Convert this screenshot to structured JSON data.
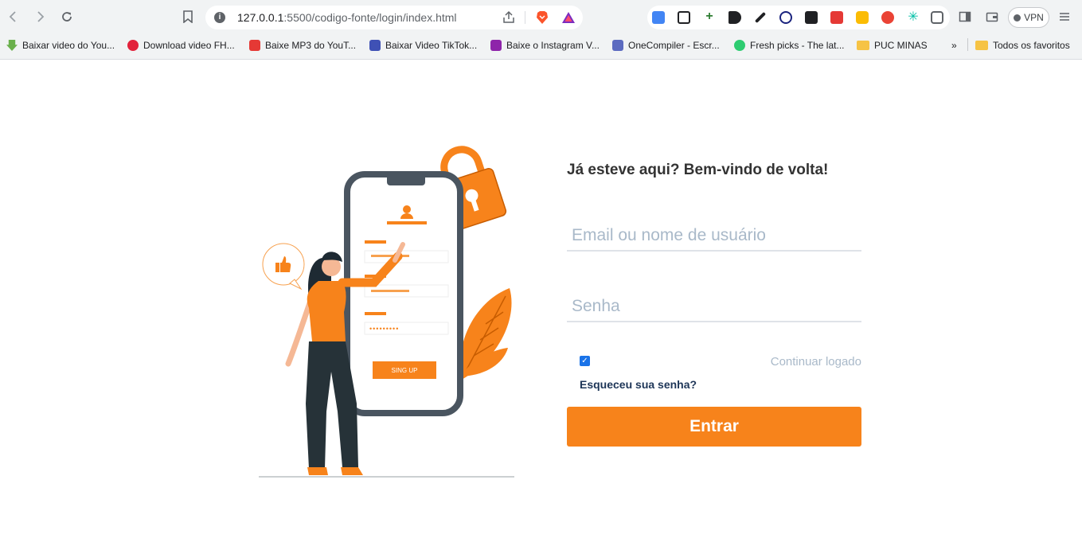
{
  "browser": {
    "url_host": "127.0.0.1",
    "url_path": ":5500/codigo-fonte/login/index.html",
    "vpn_label": "VPN",
    "bookmarks": [
      {
        "label": "Baixar video do You...",
        "color": "#6ab04c"
      },
      {
        "label": "Download video FH...",
        "color": "#e2223b"
      },
      {
        "label": "Baixe MP3 do YouT...",
        "color": "#e53935"
      },
      {
        "label": "Baixar Video TikTok...",
        "color": "#3f51b5"
      },
      {
        "label": "Baixe o Instagram V...",
        "color": "#8e24aa"
      },
      {
        "label": "OneCompiler - Escr...",
        "color": "#5c6bc0"
      },
      {
        "label": "Fresh picks - The lat...",
        "color": "#2ecc71"
      },
      {
        "label": "PUC MINAS",
        "color": "#f6c344"
      }
    ],
    "more_label": "»",
    "all_favorites_label": "Todos os favoritos"
  },
  "illustration": {
    "button_text": "SING UP",
    "password_mask": "•••••••••",
    "accent_color": "#f7831b",
    "dark_color": "#4a5560"
  },
  "login": {
    "heading": "Já esteve aqui? Bem-vindo de volta!",
    "email_placeholder": "Email ou nome de usuário",
    "email_value": "",
    "password_placeholder": "Senha",
    "password_value": "",
    "keep_logged_checked": true,
    "keep_logged_label": "Continuar logado",
    "forgot_label": "Esqueceu sua senha?",
    "submit_label": "Entrar",
    "accent_color": "#f7831b"
  }
}
